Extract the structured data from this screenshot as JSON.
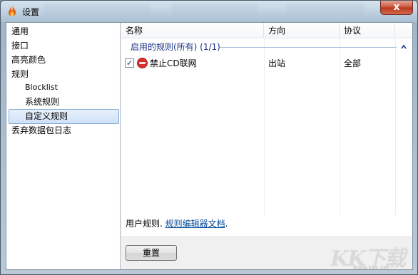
{
  "window": {
    "title": "设置",
    "close_label": "x",
    "icon": "flame-icon"
  },
  "nav": {
    "items": [
      {
        "label": "通用",
        "level": 0,
        "selected": false
      },
      {
        "label": "接口",
        "level": 0,
        "selected": false
      },
      {
        "label": "高亮颜色",
        "level": 0,
        "selected": false
      },
      {
        "label": "规则",
        "level": 0,
        "selected": false
      },
      {
        "label": "Blocklist",
        "level": 1,
        "selected": false
      },
      {
        "label": "系统规则",
        "level": 1,
        "selected": false
      },
      {
        "label": "自定义规则",
        "level": 1,
        "selected": true
      },
      {
        "label": "丢弃数据包日志",
        "level": 0,
        "selected": false
      }
    ]
  },
  "table": {
    "columns": [
      "名称",
      "方向",
      "协议"
    ],
    "group": {
      "label": "启用的规则(所有) (1/1)",
      "collapse_icon": "chevron-up-icon"
    },
    "rows": [
      {
        "checked": true,
        "check_mark": "✓",
        "icon": "block-icon",
        "name": "禁止CD联网",
        "direction": "出站",
        "protocol": "全部"
      }
    ]
  },
  "footer": {
    "text": "用户规则. ",
    "link": "规则编辑器文档",
    "suffix": "."
  },
  "buttons": {
    "reset": "重置"
  },
  "watermark": {
    "text": "KK下载",
    "sub": "www.kkx.net"
  },
  "colors": {
    "accent": "#1e3287",
    "link": "#0a4f9c",
    "close": "#c8523a"
  }
}
